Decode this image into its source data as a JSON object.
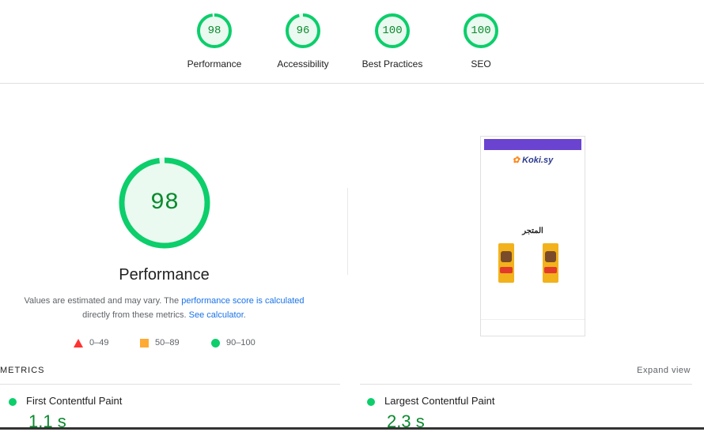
{
  "gauges": [
    {
      "score": "98",
      "label": "Performance",
      "value": 98
    },
    {
      "score": "96",
      "label": "Accessibility",
      "value": 96
    },
    {
      "score": "100",
      "label": "Best Practices",
      "value": 100
    },
    {
      "score": "100",
      "label": "SEO",
      "value": 100
    }
  ],
  "main": {
    "score": "98",
    "value": 98,
    "title": "Performance",
    "note_prefix": "Values are estimated and may vary. The ",
    "note_link1": "performance score is calculated",
    "note_mid": "directly from these metrics. ",
    "note_link2": "See calculator",
    "note_suffix": "."
  },
  "legend": {
    "fail": "0–49",
    "average": "50–89",
    "pass": "90–100"
  },
  "screenshot": {
    "brand": "Koki.sy",
    "shop_title": "المتجر"
  },
  "metrics": {
    "header": "METRICS",
    "expand_label": "Expand view",
    "items": [
      {
        "name": "First Contentful Paint",
        "value": "1.1 s"
      },
      {
        "name": "Largest Contentful Paint",
        "value": "2.3 s"
      }
    ]
  },
  "colors": {
    "pass": "#0cce6b",
    "pass_text": "#0b8a2e",
    "average": "#ffaa33",
    "fail": "#ff3333",
    "link": "#1a73e8"
  }
}
